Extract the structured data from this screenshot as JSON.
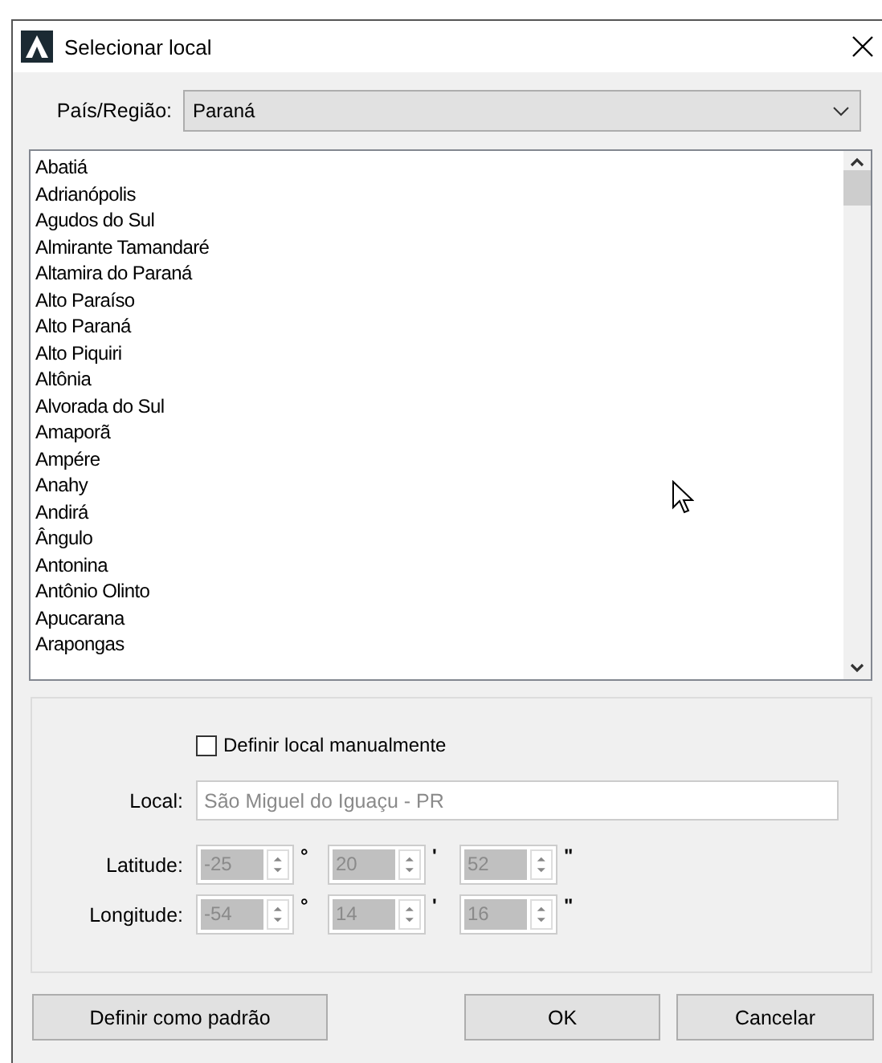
{
  "window": {
    "title": "Selecionar local"
  },
  "region": {
    "label": "País/Região:",
    "value": "Paraná"
  },
  "places": [
    {
      "name": "Abatiá",
      "selected": false
    },
    {
      "name": "Adrianópolis",
      "selected": false
    },
    {
      "name": "Agudos do Sul",
      "selected": false
    },
    {
      "name": "Almirante Tamandaré",
      "selected": false
    },
    {
      "name": "Altamira do Paraná",
      "selected": false
    },
    {
      "name": "Alto Paraíso",
      "selected": false
    },
    {
      "name": "Alto Paraná",
      "selected": false
    },
    {
      "name": "Alto Piquiri",
      "selected": false
    },
    {
      "name": "Altônia",
      "selected": false
    },
    {
      "name": "Alvorada do Sul",
      "selected": false
    },
    {
      "name": "Amaporã",
      "selected": false
    },
    {
      "name": "Ampére",
      "selected": false
    },
    {
      "name": "Anahy",
      "selected": false
    },
    {
      "name": "Andirá",
      "selected": false
    },
    {
      "name": "Ângulo",
      "selected": false
    },
    {
      "name": "Antonina",
      "selected": false
    },
    {
      "name": "Antônio Olinto",
      "selected": false
    },
    {
      "name": "Apucarana",
      "selected": false
    },
    {
      "name": "Arapongas",
      "selected": false
    }
  ],
  "manual": {
    "label": "Definir local manualmente",
    "checked": false
  },
  "local": {
    "label": "Local:",
    "value": "São Miguel do Iguaçu - PR",
    "disabled": true
  },
  "coordinates": [
    {
      "label": "Latitude:",
      "disabled": true,
      "parts": [
        {
          "value": "-25",
          "unit": "°"
        },
        {
          "value": "20",
          "unit": "'"
        },
        {
          "value": "52",
          "unit": "\""
        }
      ]
    },
    {
      "label": "Longitude:",
      "disabled": true,
      "parts": [
        {
          "value": "-54",
          "unit": "°"
        },
        {
          "value": "14",
          "unit": "'"
        },
        {
          "value": "16",
          "unit": "\""
        }
      ]
    }
  ],
  "buttons": [
    {
      "label": "Definir como padrão"
    },
    {
      "label": "OK"
    },
    {
      "label": "Cancelar"
    }
  ]
}
